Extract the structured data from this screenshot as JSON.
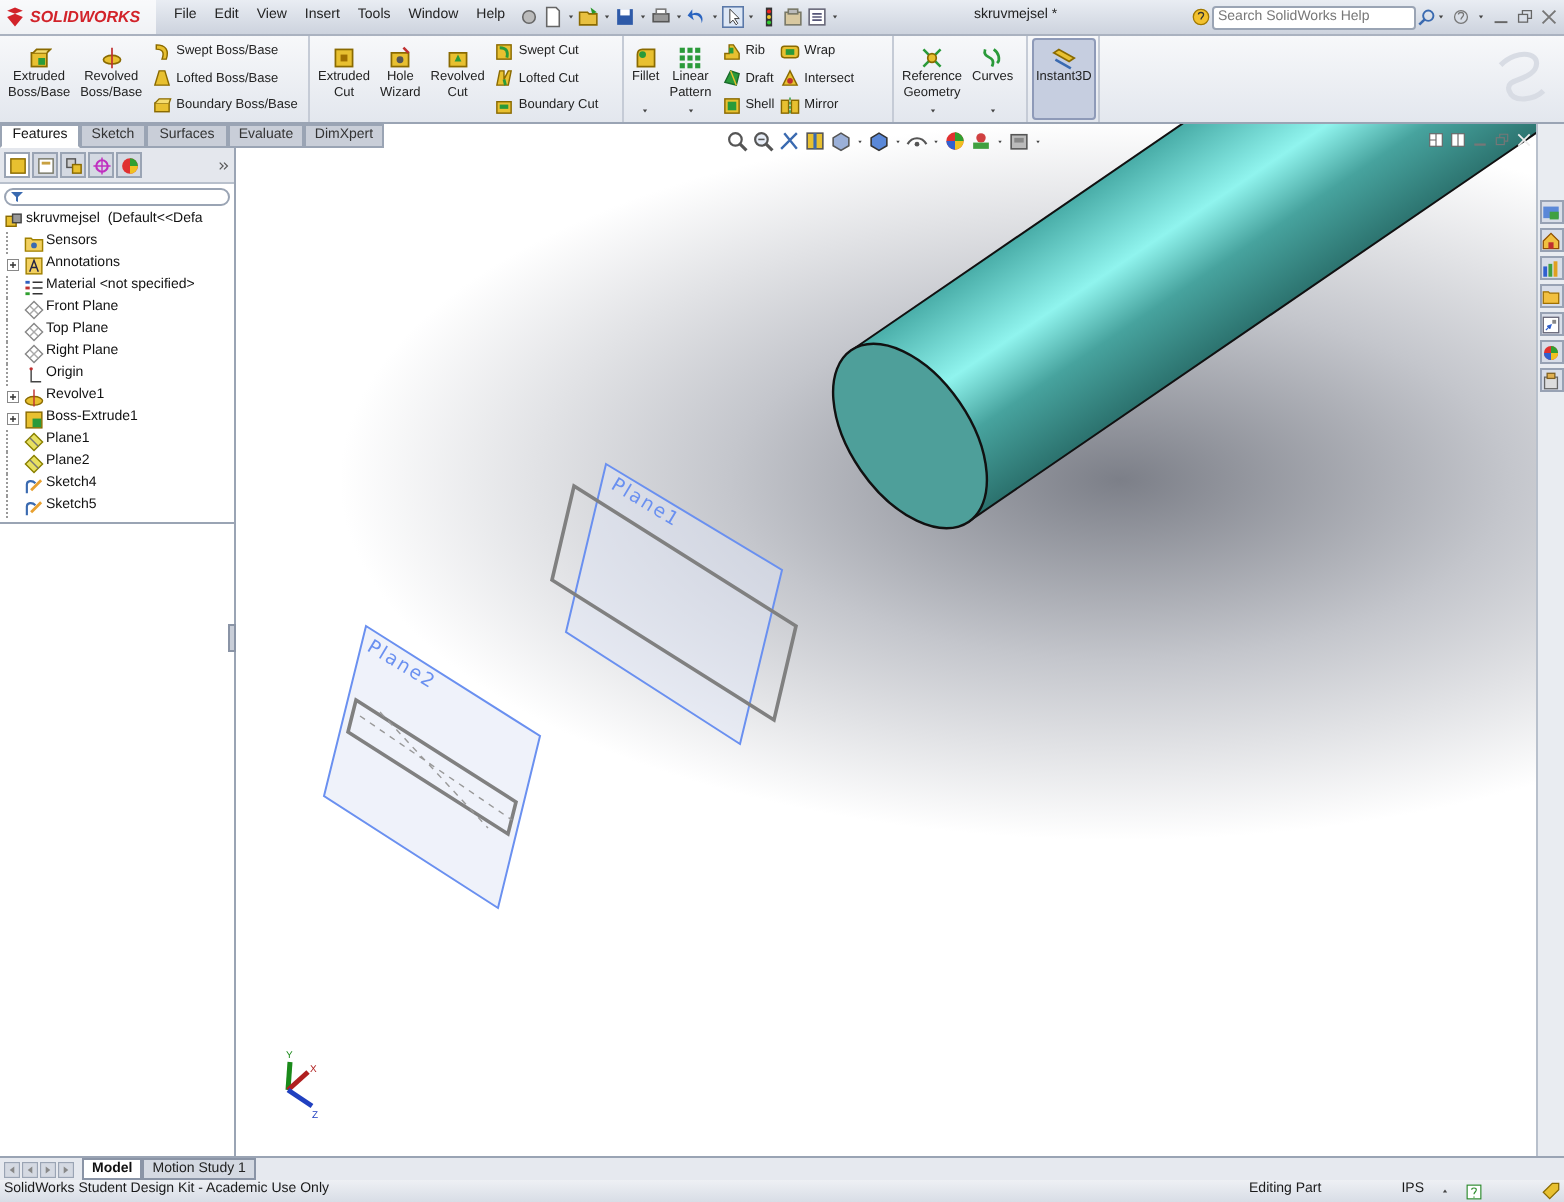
{
  "title_bar": {
    "logo": "SOLIDWORKS",
    "menu": [
      "File",
      "Edit",
      "View",
      "Insert",
      "Tools",
      "Window",
      "Help"
    ],
    "document_title": "skruvmejsel *",
    "search": {
      "placeholder": "Search SolidWorks Help"
    }
  },
  "ribbon": {
    "groups": [
      {
        "items": [
          {
            "kind": "large",
            "lines": [
              "Extruded",
              "Boss/Base"
            ],
            "dropdown": false
          },
          {
            "kind": "large",
            "lines": [
              "Revolved",
              "Boss/Base"
            ],
            "dropdown": false
          },
          {
            "kind": "stack",
            "entries": [
              "Swept Boss/Base",
              "Lofted Boss/Base",
              "Boundary Boss/Base"
            ]
          }
        ]
      },
      {
        "items": [
          {
            "kind": "large",
            "lines": [
              "Extruded",
              "Cut"
            ],
            "dropdown": false
          },
          {
            "kind": "large",
            "lines": [
              "Hole",
              "Wizard"
            ],
            "dropdown": false
          },
          {
            "kind": "large",
            "lines": [
              "Revolved",
              "Cut"
            ],
            "dropdown": false
          },
          {
            "kind": "stack",
            "entries": [
              "Swept Cut",
              "Lofted Cut",
              "Boundary Cut"
            ]
          }
        ]
      },
      {
        "items": [
          {
            "kind": "large",
            "lines": [
              "Fillet"
            ],
            "dropdown": true
          },
          {
            "kind": "large",
            "lines": [
              "Linear",
              "Pattern"
            ],
            "dropdown": true
          },
          {
            "kind": "stack",
            "entries": [
              "Rib",
              "Draft",
              "Shell"
            ]
          },
          {
            "kind": "stack",
            "entries": [
              "Wrap",
              "Intersect",
              "Mirror"
            ]
          }
        ]
      },
      {
        "items": [
          {
            "kind": "large",
            "lines": [
              "Reference",
              "Geometry"
            ],
            "dropdown": true
          },
          {
            "kind": "large",
            "lines": [
              "Curves"
            ],
            "dropdown": true
          }
        ]
      },
      {
        "items": [
          {
            "kind": "toggle",
            "lines": [
              "Instant3D"
            ],
            "selected": true
          }
        ]
      }
    ]
  },
  "command_tabs": [
    {
      "label": "Features",
      "selected": true
    },
    {
      "label": "Sketch",
      "selected": false
    },
    {
      "label": "Surfaces",
      "selected": false
    },
    {
      "label": "Evaluate",
      "selected": false
    },
    {
      "label": "DimXpert",
      "selected": false
    }
  ],
  "feature_tree": {
    "root": {
      "label": "skruvmejsel  (Default<<Defa",
      "children": [
        {
          "label": "Sensors",
          "expandable": false
        },
        {
          "label": "Annotations",
          "expandable": true
        },
        {
          "label": "Material <not specified>",
          "expandable": false
        },
        {
          "label": "Front Plane",
          "expandable": false
        },
        {
          "label": "Top Plane",
          "expandable": false
        },
        {
          "label": "Right Plane",
          "expandable": false
        },
        {
          "label": "Origin",
          "expandable": false
        },
        {
          "label": "Revolve1",
          "expandable": true
        },
        {
          "label": "Boss-Extrude1",
          "expandable": true
        },
        {
          "label": "Plane1",
          "expandable": false
        },
        {
          "label": "Plane2",
          "expandable": false
        },
        {
          "label": "Sketch4",
          "expandable": false
        },
        {
          "label": "Sketch5",
          "expandable": false
        }
      ]
    }
  },
  "viewport": {
    "plane_labels": [
      "Plane1",
      "Plane2"
    ],
    "triad_axes": [
      "Y",
      "X",
      "Z"
    ]
  },
  "bottom_tabs": [
    {
      "label": "Model",
      "selected": true
    },
    {
      "label": "Motion Study 1",
      "selected": false
    }
  ],
  "status_bar": {
    "message": "SolidWorks Student Design Kit - Academic Use Only",
    "mode": "Editing Part",
    "units": "IPS"
  }
}
